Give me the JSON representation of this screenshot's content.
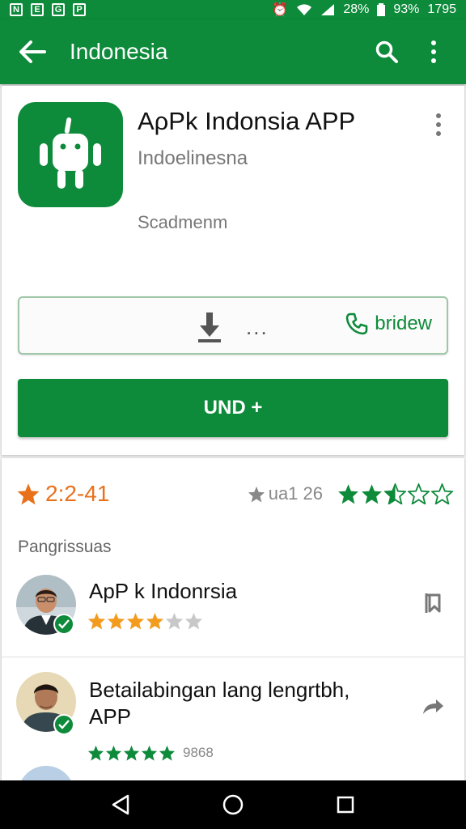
{
  "status_bar": {
    "left_icons": [
      "N",
      "E",
      "G",
      "P"
    ],
    "battery_pct": "28%",
    "battery2": "93%",
    "time": "1795"
  },
  "app_bar": {
    "title": "Indonesia",
    "icons": [
      "arrow-back-icon",
      "search-icon",
      "more-vert-icon"
    ]
  },
  "app": {
    "name": "AρPk Indonsia APP",
    "developer": "Indoelinesna",
    "category": "Scadmenm",
    "action_dots": "...",
    "call_label": "bridew",
    "install_label": "UND +",
    "colors": {
      "brand": "#0d8a3a",
      "accent": "#e8711c"
    }
  },
  "ratings": {
    "score": "2:2-41",
    "count_label": "ua1 26",
    "stars_filled": 2.5,
    "stars_total": 5,
    "section_label": "Pangrissuas"
  },
  "reviews": [
    {
      "title": "ApP k Indonrsia",
      "stars": 4,
      "stars_total": 6,
      "action_icon": "bookmark-icon"
    },
    {
      "title": "Betailabingan lanɡ lengrtbh,\nAPP",
      "stars": 5,
      "stars_total": 5,
      "count": "9868",
      "action_icon": "share-icon"
    }
  ],
  "nav_bar": {
    "icons": [
      "back-triangle-icon",
      "home-circle-icon",
      "recents-square-icon"
    ]
  }
}
